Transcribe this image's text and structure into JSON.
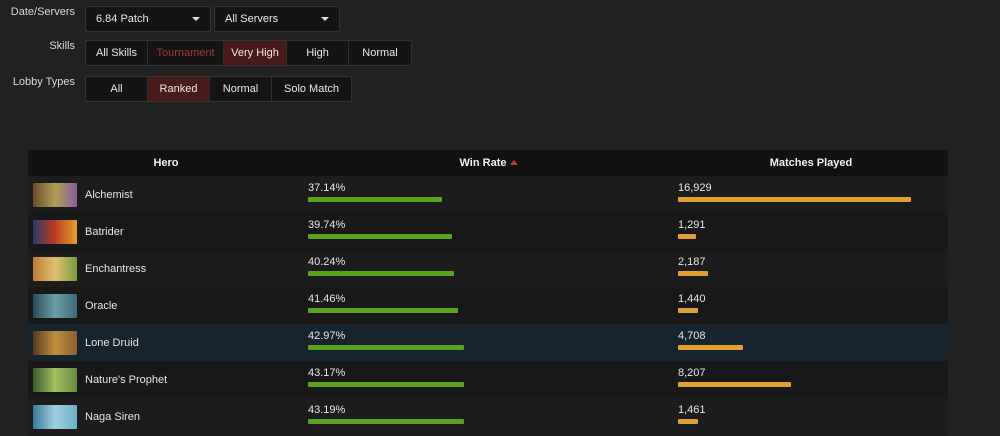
{
  "filters": {
    "date_label": "Date/Servers",
    "patch_value": "6.84 Patch",
    "servers_value": "All Servers",
    "skills_label": "Skills",
    "skills": [
      {
        "label": "All Skills",
        "state": "normal"
      },
      {
        "label": "Tournament",
        "state": "dim"
      },
      {
        "label": "Very High",
        "state": "active"
      },
      {
        "label": "High",
        "state": "normal"
      },
      {
        "label": "Normal",
        "state": "normal"
      }
    ],
    "lobby_label": "Lobby Types",
    "lobby": [
      {
        "label": "All",
        "state": "normal"
      },
      {
        "label": "Ranked",
        "state": "active"
      },
      {
        "label": "Normal",
        "state": "normal"
      },
      {
        "label": "Solo Match",
        "state": "normal"
      }
    ]
  },
  "table": {
    "headers": {
      "hero": "Hero",
      "win_rate": "Win Rate",
      "matches": "Matches Played"
    },
    "sort": {
      "column": "win_rate",
      "direction": "ascending"
    },
    "colors": {
      "win_bar": "#5aa41c",
      "matches_bar": "#e2a02c",
      "highlight_row": "#17232d"
    },
    "rows": [
      {
        "hero": "Alchemist",
        "win_rate": "37.14%",
        "win_fill": 0.3714,
        "matches": "16,929",
        "matches_fill": 0.862,
        "portrait": [
          "#6b4a2a",
          "#b0a050",
          "#8a5aa0"
        ]
      },
      {
        "hero": "Batrider",
        "win_rate": "39.74%",
        "win_fill": 0.3974,
        "matches": "1,291",
        "matches_fill": 0.066,
        "portrait": [
          "#2a3a6a",
          "#c03a20",
          "#e0a030"
        ]
      },
      {
        "hero": "Enchantress",
        "win_rate": "40.24%",
        "win_fill": 0.4024,
        "matches": "2,187",
        "matches_fill": 0.111,
        "portrait": [
          "#c07a30",
          "#e0c070",
          "#7a9a40"
        ]
      },
      {
        "hero": "Oracle",
        "win_rate": "41.46%",
        "win_fill": 0.4146,
        "matches": "1,440",
        "matches_fill": 0.073,
        "portrait": [
          "#2a4a5a",
          "#6aa0a8",
          "#3a6a7a"
        ]
      },
      {
        "hero": "Lone Druid",
        "win_rate": "42.97%",
        "win_fill": 0.4297,
        "matches": "4,708",
        "matches_fill": 0.24,
        "portrait": [
          "#5a3a1a",
          "#c09040",
          "#8a6030"
        ],
        "highlight": true
      },
      {
        "hero": "Nature's Prophet",
        "win_rate": "43.17%",
        "win_fill": 0.4317,
        "matches": "8,207",
        "matches_fill": 0.418,
        "portrait": [
          "#3a5a2a",
          "#a0c060",
          "#6a8a40"
        ]
      },
      {
        "hero": "Naga Siren",
        "win_rate": "43.19%",
        "win_fill": 0.4319,
        "matches": "1,461",
        "matches_fill": 0.074,
        "portrait": [
          "#3a7aa0",
          "#a0d0e0",
          "#6ab0c8"
        ]
      }
    ]
  }
}
